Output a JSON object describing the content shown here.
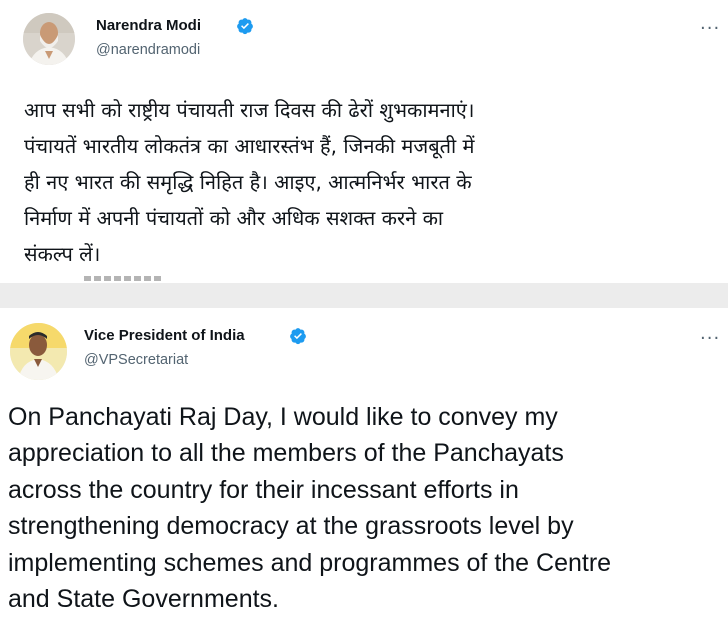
{
  "colors": {
    "verified_badge": "#1d9bf0",
    "text_primary": "#0f1419",
    "text_secondary": "#536471",
    "divider": "#ececec"
  },
  "tweets": [
    {
      "author": {
        "name": "Narendra Modi",
        "handle": "@narendramodi",
        "avatar_icon": "profile-photo",
        "verified_icon": "verified-badge-icon"
      },
      "more_icon": "more-options-icon",
      "text": "आप सभी को राष्ट्रीय पंचायती राज दिवस की ढेरों शुभकामनाएं।\nपंचायतें भारतीय लोकतंत्र का आधारस्तंभ हैं, जिनकी मजबूती में\nही नए भारत की समृद्धि निहित है। आइए, आत्मनिर्भर भारत के\nनिर्माण में अपनी पंचायतों को और अधिक सशक्त करने का\nसंकल्प लें।"
    },
    {
      "author": {
        "name": "Vice President of India",
        "handle": "@VPSecretariat",
        "avatar_icon": "profile-photo",
        "verified_icon": "verified-badge-icon"
      },
      "more_icon": "more-options-icon",
      "text": "On Panchayati Raj Day, I would like to convey my\nappreciation to all the members of the Panchayats\nacross the country for their incessant efforts in\nstrengthening democracy at the grassroots level by\nimplementing schemes and programmes of the Centre\nand State Governments."
    }
  ]
}
